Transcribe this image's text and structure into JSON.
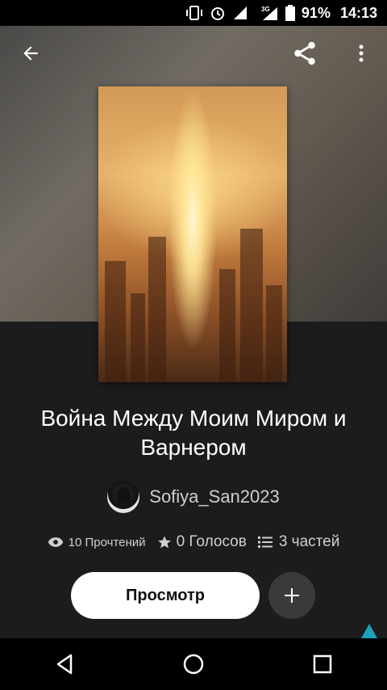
{
  "status_bar": {
    "battery": "91%",
    "time": "14:13",
    "network": "3G",
    "icons": [
      "vibrate-icon",
      "alarm-icon",
      "signal-off-icon",
      "signal-3g-icon",
      "battery-icon"
    ]
  },
  "top_bar": {
    "icons": [
      "back-arrow-icon",
      "share-icon",
      "more-vert-icon"
    ]
  },
  "story": {
    "title": "Война Между Моим Миром и Варнером",
    "author": "Sofiya_San2023",
    "reads": "10 Прочтений",
    "votes": "0 Голосов",
    "parts": "3 частей"
  },
  "actions": {
    "view_label": "Просмотр",
    "add_icon": "plus-icon"
  },
  "nav_bar": {
    "icons": [
      "back-triangle-icon",
      "home-circle-icon",
      "recents-square-icon"
    ]
  },
  "colors": {
    "background": "#1c1b1d",
    "button_bg": "#ffffff",
    "add_button_bg": "#3a3a3c",
    "accent_triangle": "#1ea0b8"
  }
}
